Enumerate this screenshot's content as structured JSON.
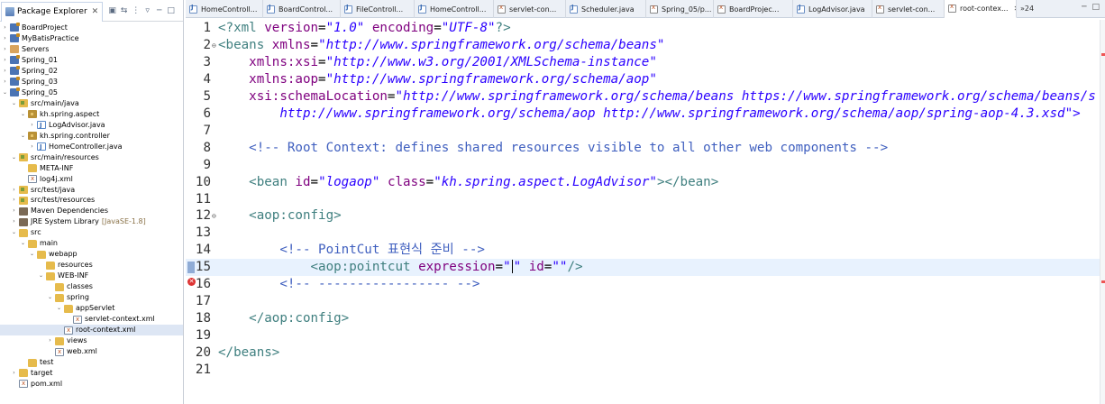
{
  "explorer": {
    "title": "Package Explorer",
    "close": "✕",
    "toolbar": [
      "▣",
      "⇆",
      "⋮",
      "▿",
      "─",
      "□"
    ],
    "items": [
      {
        "label": "BoardProject",
        "depth": 0,
        "arrow": "›",
        "icon": "project"
      },
      {
        "label": "MyBatisPractice",
        "depth": 0,
        "arrow": "›",
        "icon": "project"
      },
      {
        "label": "Servers",
        "depth": 0,
        "arrow": "›",
        "icon": "server"
      },
      {
        "label": "Spring_01",
        "depth": 0,
        "arrow": "›",
        "icon": "project"
      },
      {
        "label": "Spring_02",
        "depth": 0,
        "arrow": "›",
        "icon": "project"
      },
      {
        "label": "Spring_03",
        "depth": 0,
        "arrow": "›",
        "icon": "project"
      },
      {
        "label": "Spring_05",
        "depth": 0,
        "arrow": "⌄",
        "icon": "project"
      },
      {
        "label": "src/main/java",
        "depth": 1,
        "arrow": "⌄",
        "icon": "srcfolder"
      },
      {
        "label": "kh.spring.aspect",
        "depth": 2,
        "arrow": "⌄",
        "icon": "package"
      },
      {
        "label": "LogAdvisor.java",
        "depth": 3,
        "arrow": "›",
        "icon": "java"
      },
      {
        "label": "kh.spring.controller",
        "depth": 2,
        "arrow": "⌄",
        "icon": "package"
      },
      {
        "label": "HomeController.java",
        "depth": 3,
        "arrow": "›",
        "icon": "java"
      },
      {
        "label": "src/main/resources",
        "depth": 1,
        "arrow": "⌄",
        "icon": "srcfolder"
      },
      {
        "label": "META-INF",
        "depth": 2,
        "arrow": "",
        "icon": "folder"
      },
      {
        "label": "log4j.xml",
        "depth": 2,
        "arrow": "",
        "icon": "xml"
      },
      {
        "label": "src/test/java",
        "depth": 1,
        "arrow": "›",
        "icon": "srcfolder"
      },
      {
        "label": "src/test/resources",
        "depth": 1,
        "arrow": "›",
        "icon": "srcfolder"
      },
      {
        "label": "Maven Dependencies",
        "depth": 1,
        "arrow": "›",
        "icon": "lib"
      },
      {
        "label": "JRE System Library",
        "decor": "[JavaSE-1.8]",
        "depth": 1,
        "arrow": "›",
        "icon": "lib"
      },
      {
        "label": "src",
        "depth": 1,
        "arrow": "⌄",
        "icon": "folder"
      },
      {
        "label": "main",
        "depth": 2,
        "arrow": "⌄",
        "icon": "folder"
      },
      {
        "label": "webapp",
        "depth": 3,
        "arrow": "⌄",
        "icon": "folder"
      },
      {
        "label": "resources",
        "depth": 4,
        "arrow": "",
        "icon": "folder"
      },
      {
        "label": "WEB-INF",
        "depth": 4,
        "arrow": "⌄",
        "icon": "folder"
      },
      {
        "label": "classes",
        "depth": 5,
        "arrow": "",
        "icon": "folder"
      },
      {
        "label": "spring",
        "depth": 5,
        "arrow": "⌄",
        "icon": "folder"
      },
      {
        "label": "appServlet",
        "depth": 6,
        "arrow": "⌄",
        "icon": "folder"
      },
      {
        "label": "servlet-context.xml",
        "depth": 7,
        "arrow": "",
        "icon": "xml"
      },
      {
        "label": "root-context.xml",
        "depth": 6,
        "arrow": "",
        "icon": "xml",
        "selected": true
      },
      {
        "label": "views",
        "depth": 5,
        "arrow": "›",
        "icon": "folder"
      },
      {
        "label": "web.xml",
        "depth": 5,
        "arrow": "",
        "icon": "xml"
      },
      {
        "label": "test",
        "depth": 2,
        "arrow": "",
        "icon": "folder"
      },
      {
        "label": "target",
        "depth": 1,
        "arrow": "›",
        "icon": "folder"
      },
      {
        "label": "pom.xml",
        "depth": 1,
        "arrow": "",
        "icon": "xml"
      }
    ]
  },
  "editor": {
    "tabs": [
      {
        "label": "HomeControll...",
        "icon": "java",
        "width": 86
      },
      {
        "label": "BoardControl...",
        "icon": "java",
        "width": 86
      },
      {
        "label": "FileControll...",
        "icon": "java",
        "width": 82
      },
      {
        "label": "HomeControll...",
        "icon": "java",
        "width": 88
      },
      {
        "label": "servlet-con...",
        "icon": "xml",
        "width": 80
      },
      {
        "label": "Scheduler.java",
        "icon": "java",
        "width": 89
      },
      {
        "label": "Spring_05/p...",
        "icon": "xml",
        "width": 75
      },
      {
        "label": "BoardProjec...",
        "icon": "xml",
        "width": 88
      },
      {
        "label": "LogAdvisor.java",
        "icon": "java",
        "width": 88
      },
      {
        "label": "servlet-con...",
        "icon": "xml",
        "width": 80
      },
      {
        "label": "root-contex...",
        "icon": "xml",
        "width": 80,
        "active": true,
        "close": "✕"
      }
    ],
    "overflow": "»24",
    "window_controls": [
      "─",
      "□"
    ],
    "lines": [
      {
        "n": "1",
        "parts": [
          [
            "tag",
            "<?xml "
          ],
          [
            "attr",
            "version"
          ],
          [
            "plain",
            "="
          ],
          [
            "val",
            "\"1.0\""
          ],
          [
            "plain",
            " "
          ],
          [
            "attr",
            "encoding"
          ],
          [
            "plain",
            "="
          ],
          [
            "val",
            "\"UTF-8\""
          ],
          [
            "tag",
            "?>"
          ]
        ]
      },
      {
        "n": "2",
        "fold": "⊖",
        "parts": [
          [
            "tag",
            "<beans "
          ],
          [
            "attr",
            "xmlns"
          ],
          [
            "plain",
            "="
          ],
          [
            "val",
            "\"http://www.springframework.org/schema/beans\""
          ]
        ]
      },
      {
        "n": "3",
        "parts": [
          [
            "plain",
            "    "
          ],
          [
            "attr",
            "xmlns:xsi"
          ],
          [
            "plain",
            "="
          ],
          [
            "val",
            "\"http://www.w3.org/2001/XMLSchema-instance\""
          ]
        ]
      },
      {
        "n": "4",
        "parts": [
          [
            "plain",
            "    "
          ],
          [
            "attr",
            "xmlns:aop"
          ],
          [
            "plain",
            "="
          ],
          [
            "val",
            "\"http://www.springframework.org/schema/aop\""
          ]
        ]
      },
      {
        "n": "5",
        "parts": [
          [
            "plain",
            "    "
          ],
          [
            "attr",
            "xsi:schemaLocation"
          ],
          [
            "plain",
            "="
          ],
          [
            "val",
            "\"http://www.springframework.org/schema/beans https://www.springframework.org/schema/beans/s"
          ]
        ]
      },
      {
        "n": "6",
        "parts": [
          [
            "plain",
            "        "
          ],
          [
            "val",
            "http://www.springframework.org/schema/aop http://www.springframework.org/schema/aop/spring-aop-4.3.xsd\">"
          ]
        ]
      },
      {
        "n": "7",
        "parts": []
      },
      {
        "n": "8",
        "parts": [
          [
            "plain",
            "    "
          ],
          [
            "cmt",
            "<!-- Root Context: defines shared resources visible to all other web components -->"
          ]
        ]
      },
      {
        "n": "9",
        "parts": []
      },
      {
        "n": "10",
        "parts": [
          [
            "plain",
            "    "
          ],
          [
            "tag",
            "<bean "
          ],
          [
            "attr",
            "id"
          ],
          [
            "plain",
            "="
          ],
          [
            "val",
            "\"logaop\""
          ],
          [
            "plain",
            " "
          ],
          [
            "attr",
            "class"
          ],
          [
            "plain",
            "="
          ],
          [
            "val",
            "\"kh.spring.aspect.LogAdvisor\""
          ],
          [
            "tag",
            "></bean>"
          ]
        ]
      },
      {
        "n": "11",
        "parts": []
      },
      {
        "n": "12",
        "fold": "⊖",
        "parts": [
          [
            "plain",
            "    "
          ],
          [
            "tag",
            "<aop:config>"
          ]
        ]
      },
      {
        "n": "13",
        "parts": []
      },
      {
        "n": "14",
        "parts": [
          [
            "plain",
            "        "
          ],
          [
            "cmt",
            "<!-- PointCut 표현식 준비 -->"
          ]
        ]
      },
      {
        "n": "15",
        "current": true,
        "marker": "bookmark",
        "parts": [
          [
            "plain",
            "            "
          ],
          [
            "tag",
            "<aop:pointcut "
          ],
          [
            "attr",
            "expression"
          ],
          [
            "plain",
            "="
          ],
          [
            "val",
            "\""
          ],
          [
            "cursor",
            ""
          ],
          [
            "val",
            "\""
          ],
          [
            "plain",
            " "
          ],
          [
            "attr",
            "id"
          ],
          [
            "plain",
            "="
          ],
          [
            "val",
            "\"\""
          ],
          [
            "tag",
            "/>"
          ]
        ]
      },
      {
        "n": "16",
        "marker": "error",
        "parts": [
          [
            "plain",
            "        "
          ],
          [
            "cmt",
            "<!-- ----------------- -->"
          ]
        ]
      },
      {
        "n": "17",
        "parts": []
      },
      {
        "n": "18",
        "parts": [
          [
            "plain",
            "    "
          ],
          [
            "tag",
            "</aop:config>"
          ]
        ]
      },
      {
        "n": "19",
        "parts": []
      },
      {
        "n": "20",
        "parts": [
          [
            "tag",
            "</beans>"
          ]
        ]
      },
      {
        "n": "21",
        "parts": []
      }
    ]
  }
}
